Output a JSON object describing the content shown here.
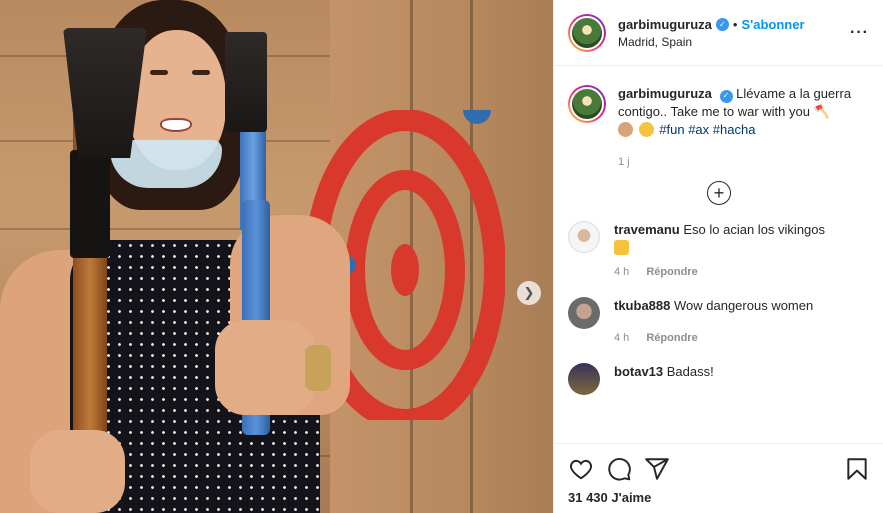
{
  "author": {
    "username": "garbimuguruza",
    "follow_label": "S'abonner",
    "separator": "•",
    "location": "Madrid, Spain"
  },
  "caption": {
    "text": "Llévame a la guerra contigo.. Take me to war with you",
    "hashtags": [
      "#fun",
      "#ax",
      "#hacha"
    ],
    "time": "1 j"
  },
  "comments": [
    {
      "username": "travemanu",
      "text": "Eso lo acian los vikingos",
      "time": "4 h",
      "reply": "Répondre"
    },
    {
      "username": "tkuba888",
      "text": "Wow dangerous women",
      "time": "4 h",
      "reply": "Répondre"
    },
    {
      "username": "botav13",
      "text": "Badass!"
    }
  ],
  "likes": {
    "count": "31 430",
    "label": "J'aime"
  },
  "icons": {
    "more": "more-options-icon",
    "verified": "verified-badge-icon",
    "load_more": "plus-circle-icon",
    "next": "chevron-right-icon",
    "like": "heart-icon",
    "comment": "comment-bubble-icon",
    "share": "paper-plane-icon",
    "save": "bookmark-icon"
  },
  "colors": {
    "accent": "#0095f6",
    "verified": "#3897f0",
    "hashtag": "#00376b",
    "meta": "#8e8e8e"
  }
}
